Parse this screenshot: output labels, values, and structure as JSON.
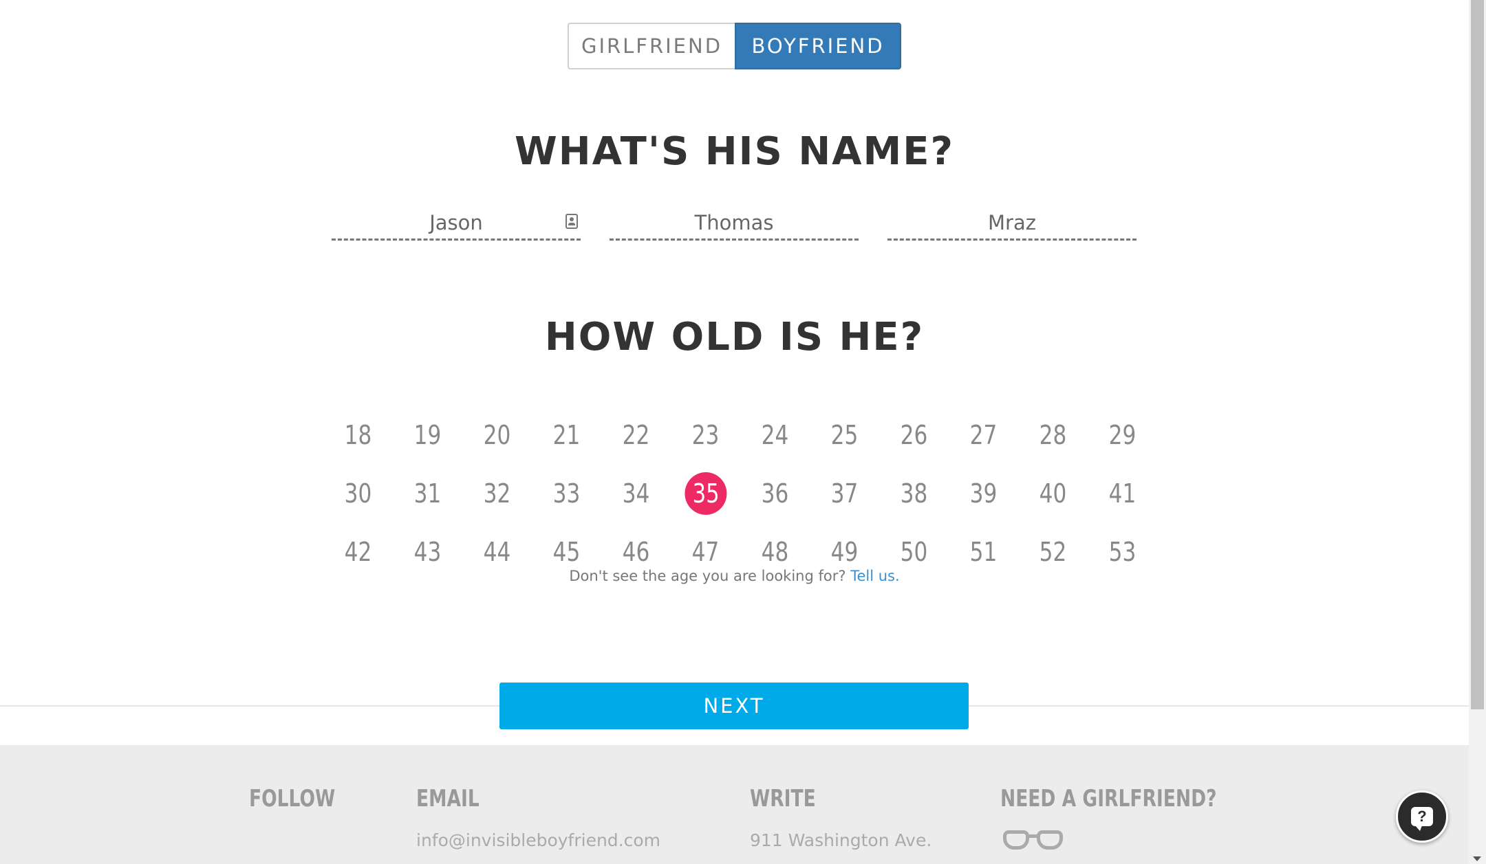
{
  "toggle": {
    "girlfriend": "GIRLFRIEND",
    "boyfriend": "BOYFRIEND",
    "selected": "boyfriend"
  },
  "name_section": {
    "heading": "WHAT'S HIS NAME?",
    "first_name": "Jason",
    "middle_name": "Thomas",
    "last_name": "Mraz"
  },
  "age_section": {
    "heading": "HOW OLD IS HE?",
    "ages": [
      "18",
      "19",
      "20",
      "21",
      "22",
      "23",
      "24",
      "25",
      "26",
      "27",
      "28",
      "29",
      "30",
      "31",
      "32",
      "33",
      "34",
      "35",
      "36",
      "37",
      "38",
      "39",
      "40",
      "41",
      "42",
      "43",
      "44",
      "45",
      "46",
      "47",
      "48",
      "49",
      "50",
      "51",
      "52",
      "53"
    ],
    "selected": "35",
    "hint_text": "Don't see the age you are looking for?",
    "hint_link": "Tell us."
  },
  "next_label": "NEXT",
  "footer": {
    "follow": "FOLLOW",
    "email_heading": "EMAIL",
    "email_value": "info@invisibleboyfriend.com",
    "write_heading": "WRITE",
    "write_value": "911 Washington Ave.",
    "need_heading": "NEED A GIRLFRIEND?"
  },
  "colors": {
    "accent": "#337ab7",
    "selected_age": "#ee2a64",
    "next_button": "#00aae8"
  },
  "help_icon": "question-chat-icon"
}
